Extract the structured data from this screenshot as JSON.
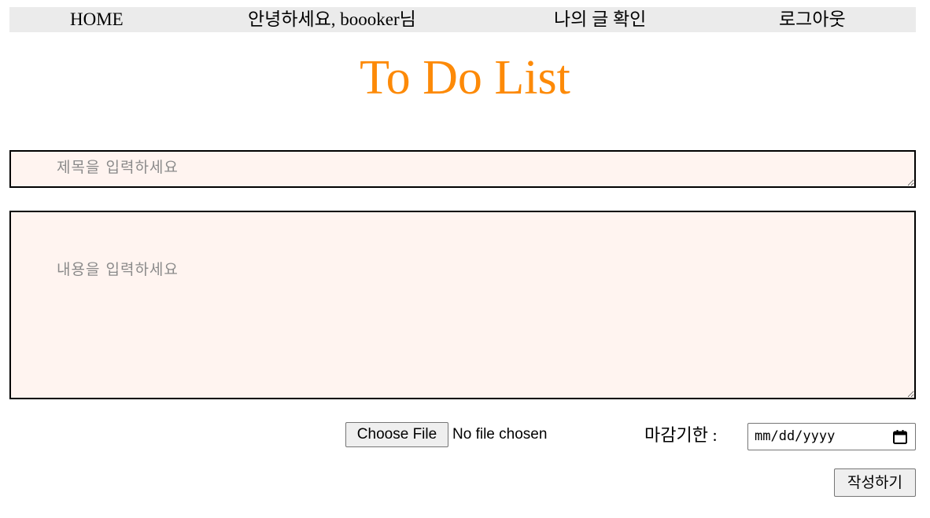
{
  "nav": {
    "home": "HOME",
    "greeting": "안녕하세요, boooker님",
    "my_posts": "나의 글 확인",
    "logout": "로그아웃"
  },
  "page": {
    "title": "To Do List",
    "title_color": "#fd8a08"
  },
  "form": {
    "title_placeholder": "제목을 입력하세요",
    "title_value": "",
    "content_placeholder": "내용을 입력하세요",
    "content_value": "",
    "file_button_label": "Choose File",
    "file_status": "No file chosen",
    "deadline_label": "마감기한 :",
    "deadline_placeholder": "mm/dd/yyyy",
    "submit_label": "작성하기",
    "field_background": "#fff4f0"
  },
  "icons": {
    "date_picker": "calendar-icon"
  }
}
